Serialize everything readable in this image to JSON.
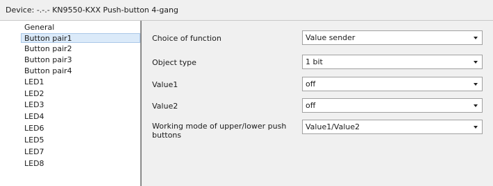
{
  "device_title": "Device: -.-.- KN9550-KXX Push-button 4-gang",
  "sidebar": {
    "items": [
      {
        "label": "General"
      },
      {
        "label": "Button pair1"
      },
      {
        "label": "Button pair2"
      },
      {
        "label": "Button pair3"
      },
      {
        "label": "Button pair4"
      },
      {
        "label": "LED1"
      },
      {
        "label": "LED2"
      },
      {
        "label": "LED3"
      },
      {
        "label": "LED4"
      },
      {
        "label": "LED6"
      },
      {
        "label": "LED5"
      },
      {
        "label": "LED7"
      },
      {
        "label": "LED8"
      }
    ],
    "selected": "Button pair1"
  },
  "params": [
    {
      "label": "Choice of function",
      "value": "Value sender"
    },
    {
      "label": "Object type",
      "value": "1 bit"
    },
    {
      "label": "Value1",
      "value": "off"
    },
    {
      "label": "Value2",
      "value": "off"
    },
    {
      "label": "Working mode of upper/lower push buttons",
      "value": "Value1/Value2"
    }
  ],
  "icons": {
    "dropdown": "chevron-down-icon"
  },
  "colors": {
    "background": "#f0f0f0",
    "panel": "#ffffff",
    "selection": "#dbeaf9",
    "selection_border": "#a9c7e8",
    "divider": "#8a8a8a"
  }
}
